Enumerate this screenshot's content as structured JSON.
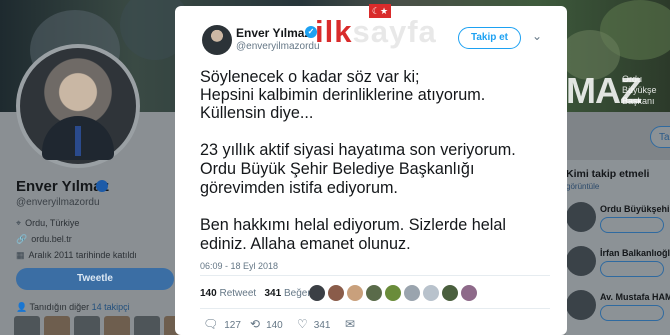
{
  "background_profile": {
    "name": "Enver Yılmaz",
    "handle": "@enveryilmazordu",
    "location": "Ordu, Türkiye",
    "website": "ordu.bel.tr",
    "joined": "Aralık 2011 tarihinde katıldı",
    "tweet_button": "Tweetle",
    "mutual_prefix": "Tanıdığın diğer",
    "mutual_link": "14 takipçi"
  },
  "banner_text": {
    "big": "MAZ",
    "line1": "Ordu",
    "line2": "Büyükşe",
    "line3": "Başkanı"
  },
  "right_panel": {
    "follow_button": "Ta",
    "title": "Kimi takip etmeli",
    "subtitle": "görüntüle",
    "suggestions": [
      {
        "name": "Ordu Büyükşehir"
      },
      {
        "name": "İrfan Balkanlıoğlu"
      },
      {
        "name": "Av. Mustafa HAM"
      }
    ]
  },
  "watermark": {
    "part1": "ilk",
    "part2": "sayfa"
  },
  "tweet": {
    "author_name": "Enver Yılmaz",
    "verified_icon": "verified-badge-icon",
    "author_handle": "@enveryilmazordu",
    "follow_label": "Takip et",
    "body_lines": [
      "Söylenecek o kadar söz var ki;",
      "Hepsini kalbimin derinliklerine atıyorum.",
      "Küllensin diye...",
      "",
      "23 yıllık aktif siyasi hayatıma son veriyorum.",
      "Ordu Büyük Şehir Belediye Başkanlığı",
      "görevimden istifa ediyorum.",
      "",
      "Ben hakkımı helal ediyorum. Sizlerde helal",
      "ediniz. Allaha emanet olunuz."
    ],
    "timestamp": "06:09 - 18 Eyl 2018",
    "retweet_count": "140",
    "retweet_label": "Retweet",
    "like_count": "341",
    "like_label": "Beğeni",
    "actions": {
      "reply_count": "127",
      "retweet_count": "140",
      "like_count": "341"
    }
  }
}
